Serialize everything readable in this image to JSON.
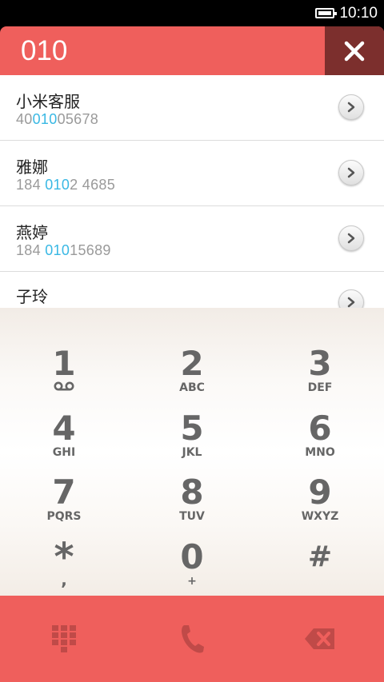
{
  "status_bar": {
    "time": "10:10",
    "battery_icon": "battery-icon"
  },
  "header": {
    "number": "010",
    "close_icon": "close-icon"
  },
  "contacts": [
    {
      "name": "小米客服",
      "number_pre": "40",
      "number_hl": "010",
      "number_post": "05678"
    },
    {
      "name": "雅娜",
      "number_pre": "184 ",
      "number_hl": "010",
      "number_post": "2 4685"
    },
    {
      "name": "燕婷",
      "number_pre": "184 ",
      "number_hl": "010",
      "number_post": "15689"
    },
    {
      "name": "子玲",
      "number_pre": "",
      "number_hl": "",
      "number_post": ""
    }
  ],
  "keypad": [
    {
      "digit": "1",
      "letters": "",
      "icon": "voicemail-icon"
    },
    {
      "digit": "2",
      "letters": "ABC"
    },
    {
      "digit": "3",
      "letters": "DEF"
    },
    {
      "digit": "4",
      "letters": "GHI"
    },
    {
      "digit": "5",
      "letters": "JKL"
    },
    {
      "digit": "6",
      "letters": "MNO"
    },
    {
      "digit": "7",
      "letters": "PQRS"
    },
    {
      "digit": "8",
      "letters": "TUV"
    },
    {
      "digit": "9",
      "letters": "WXYZ"
    },
    {
      "digit": "*",
      "letters": ","
    },
    {
      "digit": "0",
      "letters": "+"
    },
    {
      "digit": "#",
      "letters": ""
    }
  ],
  "bottom_bar": {
    "icons": [
      "dialpad-grid-icon",
      "phone-icon",
      "backspace-icon"
    ]
  },
  "colors": {
    "accent": "#ef5f5c",
    "close_bg": "#7c2f2d",
    "highlight": "#39b8e4",
    "key_text": "#666666"
  }
}
